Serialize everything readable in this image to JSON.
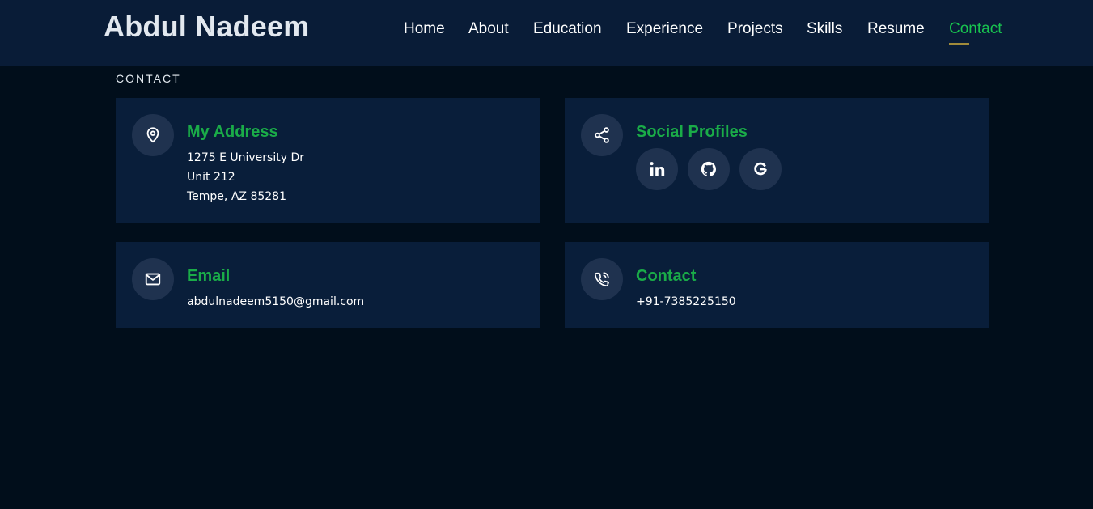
{
  "header": {
    "brand": "Abdul Nadeem",
    "nav": [
      {
        "label": "Home"
      },
      {
        "label": "About"
      },
      {
        "label": "Education"
      },
      {
        "label": "Experience"
      },
      {
        "label": "Projects"
      },
      {
        "label": "Skills"
      },
      {
        "label": "Resume"
      },
      {
        "label": "Contact",
        "active": true
      }
    ]
  },
  "section": {
    "label": "CONTACT"
  },
  "cards": {
    "address": {
      "icon": "map-pin-icon",
      "title": "My Address",
      "lines": [
        "1275 E University Dr",
        "Unit 212",
        "Tempe, AZ 85281"
      ]
    },
    "social": {
      "icon": "share-icon",
      "title": "Social Profiles",
      "links": [
        {
          "icon": "linkedin-icon",
          "name": "LinkedIn"
        },
        {
          "icon": "github-icon",
          "name": "GitHub"
        },
        {
          "icon": "google-icon",
          "name": "Google"
        }
      ]
    },
    "email": {
      "icon": "envelope-icon",
      "title": "Email",
      "value": "abdulnadeem5150@gmail.com"
    },
    "contact": {
      "icon": "phone-call-icon",
      "title": "Contact",
      "value": "+91-7385225150"
    }
  },
  "colors": {
    "header_bg": "#091c37",
    "page_bg": "#010e1b",
    "card_bg": "#091e3a",
    "icon_circle_bg": "#1f324f",
    "accent_green": "#1aac48",
    "active_nav": "#18c44f",
    "nav_underline": "#a08a3a"
  }
}
